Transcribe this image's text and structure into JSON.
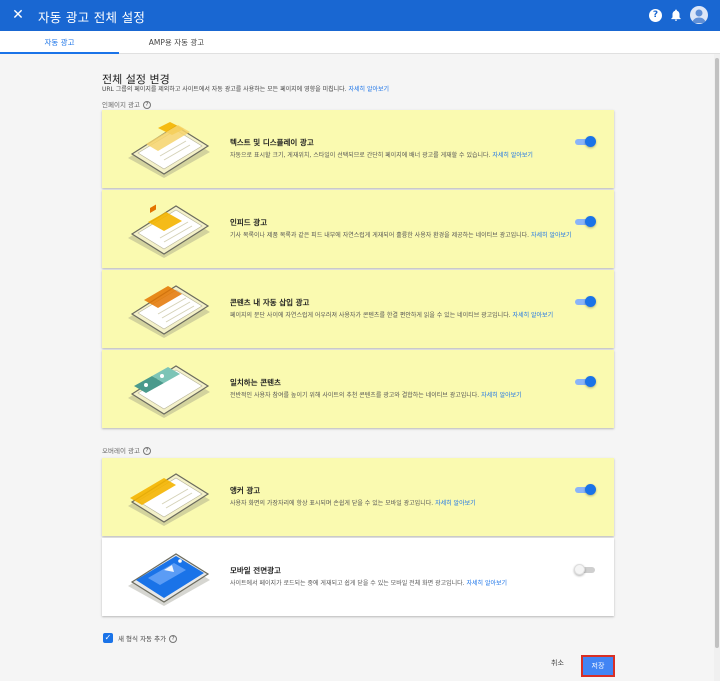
{
  "appbar": {
    "title": "자동 광고 전체 설정",
    "close_glyph": "✕",
    "help_glyph": "?",
    "close_icon": "close-icon",
    "help_icon": "help-icon",
    "bell_icon": "bell-icon",
    "avatar_icon": "account-avatar-icon"
  },
  "tabs": [
    {
      "label": "자동 광고",
      "active": true
    },
    {
      "label": "AMP용 자동 광고",
      "active": false
    }
  ],
  "header": {
    "title": "전체 설정 변경",
    "description": "URL 그룹의 페이지를 제외하고 사이트에서 자동 광고를 사용하는 모든 페이지에 영향을 미칩니다.",
    "learn_more": "자세히 알아보기"
  },
  "sections": {
    "inpage": {
      "label": "인페이지 광고"
    },
    "overlay": {
      "label": "오버레이 광고"
    }
  },
  "help_mark": "?",
  "cards": [
    {
      "name": "텍스트 및 디스플레이 광고",
      "desc": "자동으로 표시할 크기, 게재위치, 스타일이 선택되므로 간단히 페이지에 배너 광고를 게재할 수 있습니다.",
      "link": "자세히 알아보기",
      "enabled": true
    },
    {
      "name": "인피드 광고",
      "desc": "기사 목록이나 제품 목록과 같은 피드 내부에 자연스럽게 게재되어 훌륭한 사용자 환경을 제공하는 네이티브 광고입니다.",
      "link": "자세히 알아보기",
      "enabled": true
    },
    {
      "name": "콘텐츠 내 자동 삽입 광고",
      "desc": "페이지의 문단 사이에 자연스럽게 어우러져 사용자가 콘텐츠를 한결 편안하게 읽을 수 있는 네이티브 광고입니다.",
      "link": "자세히 알아보기",
      "enabled": true
    },
    {
      "name": "일치하는 콘텐츠",
      "desc": "전반적인 사용자 참여를 높이기 위해 사이트의 추천 콘텐츠를 광고와 결합하는 네이티브 광고입니다.",
      "link": "자세히 알아보기",
      "enabled": true
    },
    {
      "name": "앵커 광고",
      "desc": "사용자 화면의 가장자리에 항상 표시되며 손쉽게 닫을 수 있는 모바일 광고입니다.",
      "link": "자세히 알아보기",
      "enabled": true
    },
    {
      "name": "모바일 전면광고",
      "desc": "사이트에서 페이지가 로드되는 중에 게재되고 쉽게 닫을 수 있는 모바일 전체 화면 광고입니다.",
      "link": "자세히 알아보기",
      "enabled": false
    }
  ],
  "auto_add": {
    "label": "새 형식 자동 추가",
    "checked": true,
    "check_glyph": "✓"
  },
  "footer": {
    "cancel": "취소",
    "save": "저장"
  },
  "colors": {
    "brand": "#1967d2",
    "accent": "#1a73e8",
    "card_highlight": "#fafab0",
    "save_outline": "#d93025"
  }
}
